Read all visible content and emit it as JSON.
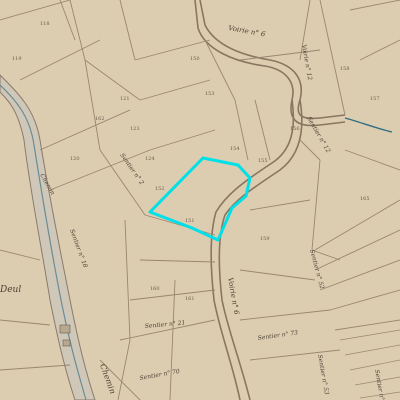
{
  "map": {
    "kind": "cadastral plan (hand-drawn)",
    "paper_color": "#d8c8aa",
    "ink_color": "#8a7560",
    "water_color": "#4a7a8c",
    "highlight_color": "#00e0e8",
    "labels": {
      "road_n": "Voirie n° 6",
      "road_s": "Voirie n° 6",
      "sentier_n": "Sentier n° 12",
      "sentier_w": "Sentier n° 18",
      "sentier_e": "Sentier n° 52",
      "sentier_c": "Sentier n° 2",
      "sentier_se": "Sentier n° 73",
      "sentier_s": "Sentier n° 21",
      "chemin_w": "Chemin",
      "sentier_bottom": "Sentier n° 70",
      "sentier_br": "Sentier n° 85",
      "sentier_mr": "Sentier n° 53",
      "voirie_top": "Voirie n° 12",
      "place_name": "Deul"
    },
    "parcel_numbers": [
      "121",
      "123",
      "124",
      "152",
      "151",
      "150",
      "153",
      "154",
      "155",
      "156",
      "157",
      "158",
      "159",
      "160",
      "161",
      "162",
      "120",
      "119",
      "118",
      "165"
    ]
  }
}
